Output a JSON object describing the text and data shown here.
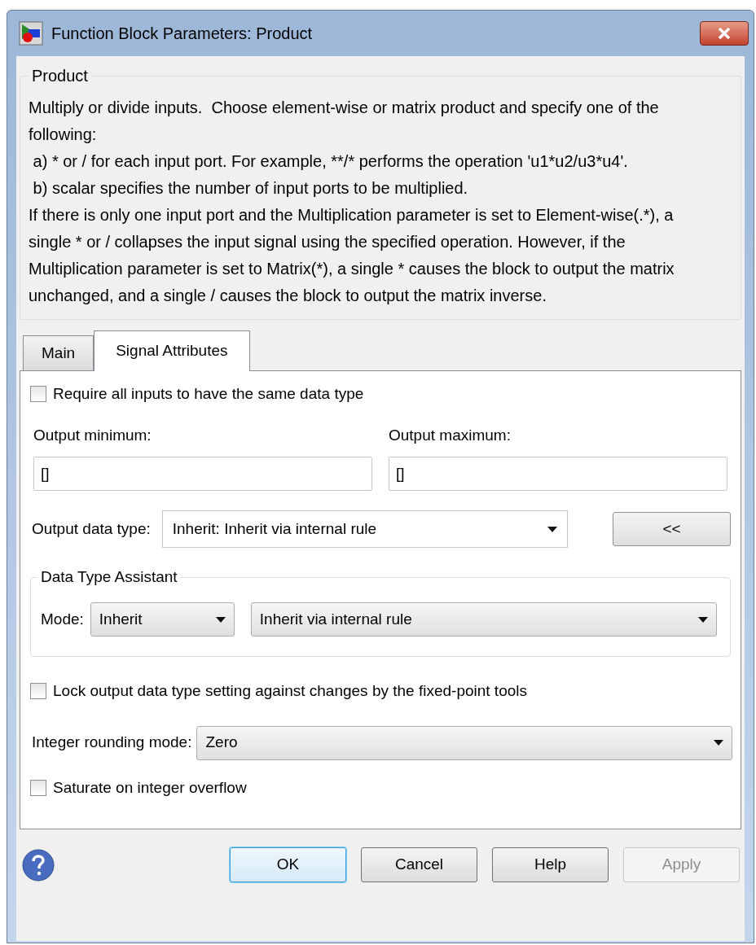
{
  "window": {
    "title": "Function Block Parameters: Product"
  },
  "group": {
    "title": "Product",
    "paragraphs": [
      "Multiply or divide inputs.  Choose element-wise or matrix product and specify one of the following:",
      " a) * or / for each input port. For example, **/* performs the operation 'u1*u2/u3*u4'.",
      " b) scalar specifies the number of input ports to be multiplied.",
      "If there is only one input port and the Multiplication parameter is set to Element-wise(.*), a single * or / collapses the input signal using the specified operation. However, if the Multiplication parameter is set to Matrix(*), a single * causes the block to output the matrix unchanged, and a single / causes the block to output the matrix inverse."
    ]
  },
  "tabs": [
    {
      "label": "Main",
      "selected": false
    },
    {
      "label": "Signal Attributes",
      "selected": true
    }
  ],
  "require_same_type": {
    "label": "Require all inputs to have the same data type",
    "checked": false
  },
  "output_minimum": {
    "label": "Output minimum:",
    "value": "[]"
  },
  "output_maximum": {
    "label": "Output maximum:",
    "value": "[]"
  },
  "output_data_type": {
    "label": "Output data type:",
    "value": "Inherit: Inherit via internal rule",
    "button": "<<"
  },
  "assistant": {
    "title": "Data Type Assistant",
    "mode_label": "Mode:",
    "mode": "Inherit",
    "rule": "Inherit via internal rule"
  },
  "lock_type": {
    "label": "Lock output data type setting against changes by the fixed-point tools",
    "checked": false
  },
  "rounding": {
    "label": "Integer rounding mode:",
    "value": "Zero"
  },
  "saturate": {
    "label": "Saturate on integer overflow",
    "checked": false
  },
  "buttons": [
    {
      "label": "OK",
      "default": true,
      "disabled": false
    },
    {
      "label": "Cancel",
      "default": false,
      "disabled": false
    },
    {
      "label": "Help",
      "default": false,
      "disabled": false
    },
    {
      "label": "Apply",
      "default": false,
      "disabled": true
    }
  ]
}
